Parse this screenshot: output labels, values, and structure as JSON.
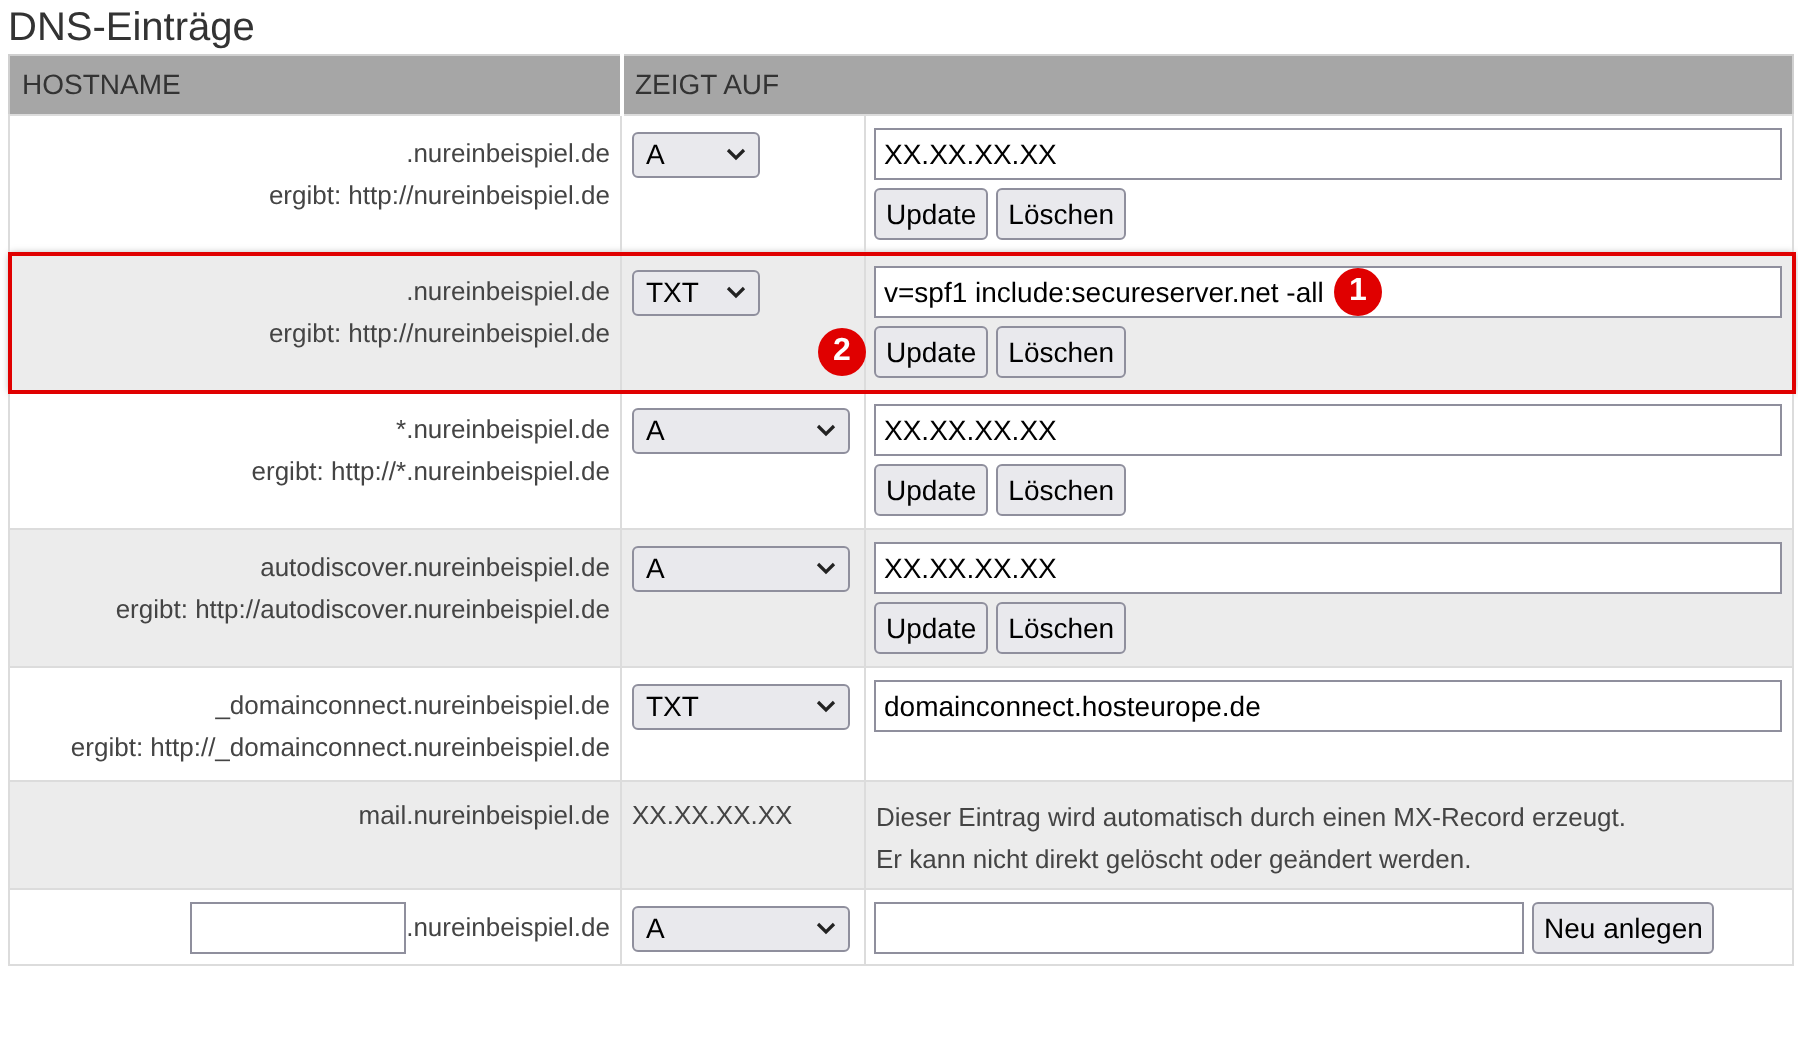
{
  "title": "DNS-Einträge",
  "columns": [
    "HOSTNAME",
    "ZEIGT AUF"
  ],
  "rows": [
    {
      "kind": "record",
      "host": ".nureinbeispiel.de",
      "result": "ergibt: http://nureinbeispiel.de",
      "type": "A",
      "compact_select": true,
      "value": "XX.XX.XX.XX",
      "buttons": [
        "Update",
        "Löschen"
      ],
      "highlighted": false
    },
    {
      "kind": "record",
      "host": ".nureinbeispiel.de",
      "result": "ergibt: http://nureinbeispiel.de",
      "type": "TXT",
      "compact_select": true,
      "value": "v=spf1 include:secureserver.net -all",
      "buttons": [
        "Update",
        "Löschen"
      ],
      "highlighted": true,
      "value_marker": "1",
      "button_marker": "2"
    },
    {
      "kind": "record",
      "host": "*.nureinbeispiel.de",
      "result": "ergibt: http://*.nureinbeispiel.de",
      "type": "A",
      "compact_select": false,
      "value": "XX.XX.XX.XX",
      "buttons": [
        "Update",
        "Löschen"
      ],
      "highlighted": false
    },
    {
      "kind": "record",
      "host": "autodiscover.nureinbeispiel.de",
      "result": "ergibt: http://autodiscover.nureinbeispiel.de",
      "type": "A",
      "compact_select": false,
      "value": "XX.XX.XX.XX",
      "buttons": [
        "Update",
        "Löschen"
      ],
      "highlighted": false
    },
    {
      "kind": "record",
      "host": "_domainconnect.nureinbeispiel.de",
      "result": "ergibt: http://_domainconnect.nureinbeispiel.de",
      "type": "TXT",
      "compact_select": false,
      "value": "domainconnect.hosteurope.de",
      "highlighted": false
    },
    {
      "kind": "auto",
      "host": "mail.nureinbeispiel.de",
      "target": "XX.XX.XX.XX",
      "notes": [
        "Dieser Eintrag wird automatisch durch einen MX-Record erzeugt.",
        "Er kann nicht direkt gelöscht oder geändert werden."
      ]
    },
    {
      "kind": "new",
      "suffix": ".nureinbeispiel.de",
      "type": "A",
      "button": "Neu anlegen"
    }
  ]
}
